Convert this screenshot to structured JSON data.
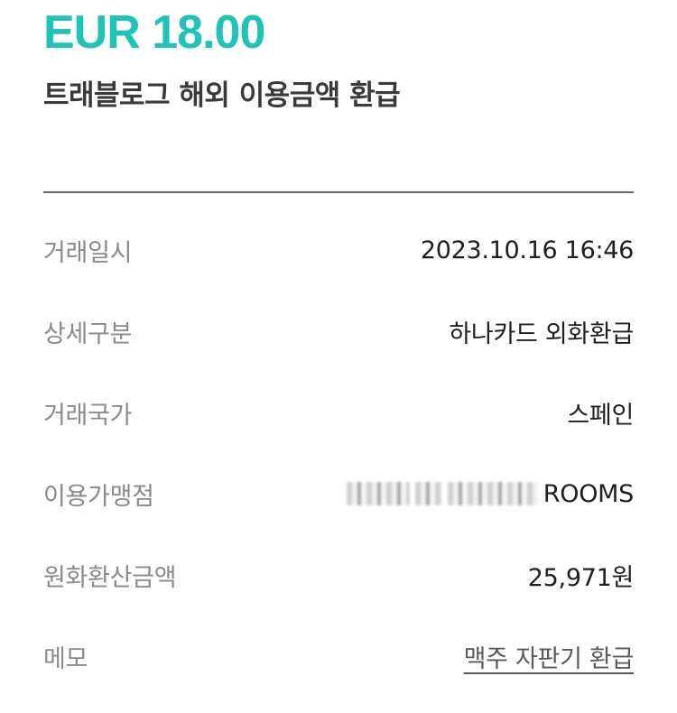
{
  "header": {
    "amount": "EUR 18.00",
    "subtitle": "트래블로그 해외 이용금액 환급"
  },
  "details": {
    "transaction_date": {
      "label": "거래일시",
      "value": "2023.10.16 16:46"
    },
    "detail_type": {
      "label": "상세구분",
      "value": "하나카드 외화환급"
    },
    "country": {
      "label": "거래국가",
      "value": "스페인"
    },
    "merchant": {
      "label": "이용가맹점",
      "value_visible_suffix": "ROOMS"
    },
    "krw_amount": {
      "label": "원화환산금액",
      "value": "25,971원"
    },
    "memo": {
      "label": "메모",
      "value": "맥주 자판기 환급"
    }
  },
  "colors": {
    "accent": "#1fc4b6",
    "label": "#8a8a8a",
    "divider": "#6b6b6b"
  }
}
